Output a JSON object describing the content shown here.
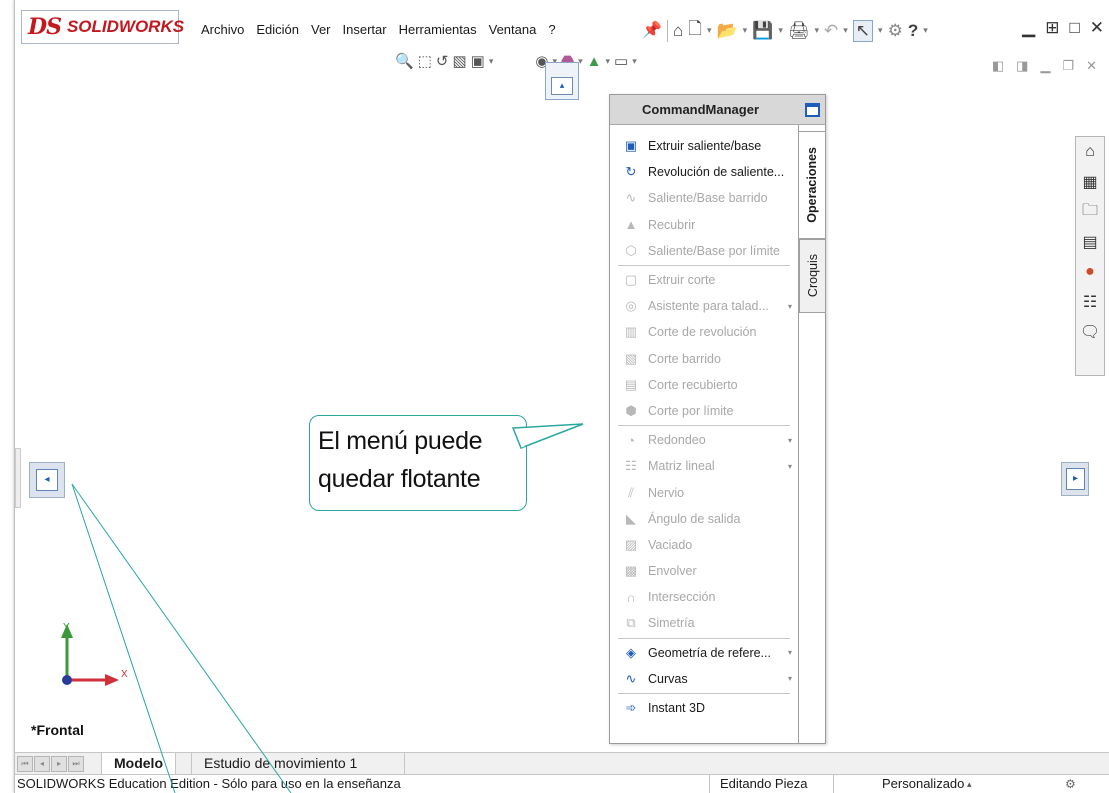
{
  "app": {
    "logo_ds": "DS",
    "logo_name": "SOLIDWORKS"
  },
  "menu": [
    "Archivo",
    "Edición",
    "Ver",
    "Insertar",
    "Herramientas",
    "Ventana",
    "?"
  ],
  "qat_icons": [
    "home-icon",
    "new-document-icon",
    "open-icon",
    "save-icon",
    "print-icon",
    "undo-icon",
    "select-icon",
    "options-icon",
    "help-icon"
  ],
  "hud_icons": [
    "zoom-to-fit-icon",
    "zoom-area-icon",
    "previous-view-icon",
    "section-view-icon",
    "view-orientation-icon",
    "display-style-icon",
    "hide-show-icon",
    "edit-appearance-icon",
    "apply-scene-icon",
    "view-settings-icon"
  ],
  "command_manager": {
    "title": "CommandManager",
    "tabs": {
      "active": "Operaciones",
      "other": "Croquis"
    },
    "items": [
      {
        "label": "Extruir saliente/base",
        "enabled": true,
        "icon": "extrude-boss-icon"
      },
      {
        "label": "Revolución de saliente...",
        "enabled": true,
        "icon": "revolve-boss-icon"
      },
      {
        "label": "Saliente/Base barrido",
        "enabled": false,
        "icon": "swept-boss-icon"
      },
      {
        "label": "Recubrir",
        "enabled": false,
        "icon": "loft-icon"
      },
      {
        "label": "Saliente/Base por límite",
        "enabled": false,
        "icon": "boundary-boss-icon",
        "sep_after": true
      },
      {
        "label": "Extruir corte",
        "enabled": false,
        "icon": "extruded-cut-icon"
      },
      {
        "label": "Asistente para talad...",
        "enabled": false,
        "icon": "hole-wizard-icon",
        "dropdown": true
      },
      {
        "label": "Corte de revolución",
        "enabled": false,
        "icon": "revolved-cut-icon"
      },
      {
        "label": "Corte barrido",
        "enabled": false,
        "icon": "swept-cut-icon"
      },
      {
        "label": "Corte recubierto",
        "enabled": false,
        "icon": "lofted-cut-icon"
      },
      {
        "label": "Corte por límite",
        "enabled": false,
        "icon": "boundary-cut-icon",
        "sep_after": true
      },
      {
        "label": "Redondeo",
        "enabled": false,
        "icon": "fillet-icon",
        "dropdown": true
      },
      {
        "label": "Matriz lineal",
        "enabled": false,
        "icon": "linear-pattern-icon",
        "dropdown": true
      },
      {
        "label": "Nervio",
        "enabled": false,
        "icon": "rib-icon"
      },
      {
        "label": "Ángulo de salida",
        "enabled": false,
        "icon": "draft-icon"
      },
      {
        "label": "Vaciado",
        "enabled": false,
        "icon": "shell-icon"
      },
      {
        "label": "Envolver",
        "enabled": false,
        "icon": "wrap-icon"
      },
      {
        "label": "Intersección",
        "enabled": false,
        "icon": "intersect-icon"
      },
      {
        "label": "Simetría",
        "enabled": false,
        "icon": "mirror-icon",
        "sep_after": true
      },
      {
        "label": "Geometría de refere...",
        "enabled": true,
        "icon": "reference-geometry-icon",
        "dropdown": true
      },
      {
        "label": "Curvas",
        "enabled": true,
        "icon": "curves-icon",
        "dropdown": true,
        "sep_after": true
      },
      {
        "label": "Instant 3D",
        "enabled": true,
        "icon": "instant3d-icon"
      }
    ]
  },
  "callout": {
    "line1": "El menú puede",
    "line2": "quedar flotante"
  },
  "task_pane_icons": [
    "home-icon",
    "design-library-icon",
    "file-explorer-icon",
    "view-palette-icon",
    "appearances-icon",
    "custom-properties-icon",
    "forum-icon"
  ],
  "triad": {
    "y_label": "Y",
    "x_label": "X"
  },
  "view_name": "*Frontal",
  "bottom_tabs": [
    {
      "label": "Modelo",
      "active": true
    },
    {
      "label": "Estudio de movimiento 1",
      "active": false
    }
  ],
  "status": {
    "left": "SOLIDWORKS Education Edition - Sólo para uso en la enseñanza",
    "mode": "Editando Pieza",
    "units": "Personalizado"
  },
  "colors": {
    "brand": "#c4181f",
    "accent": "#1f5db8",
    "callout": "#2aa8a0"
  }
}
